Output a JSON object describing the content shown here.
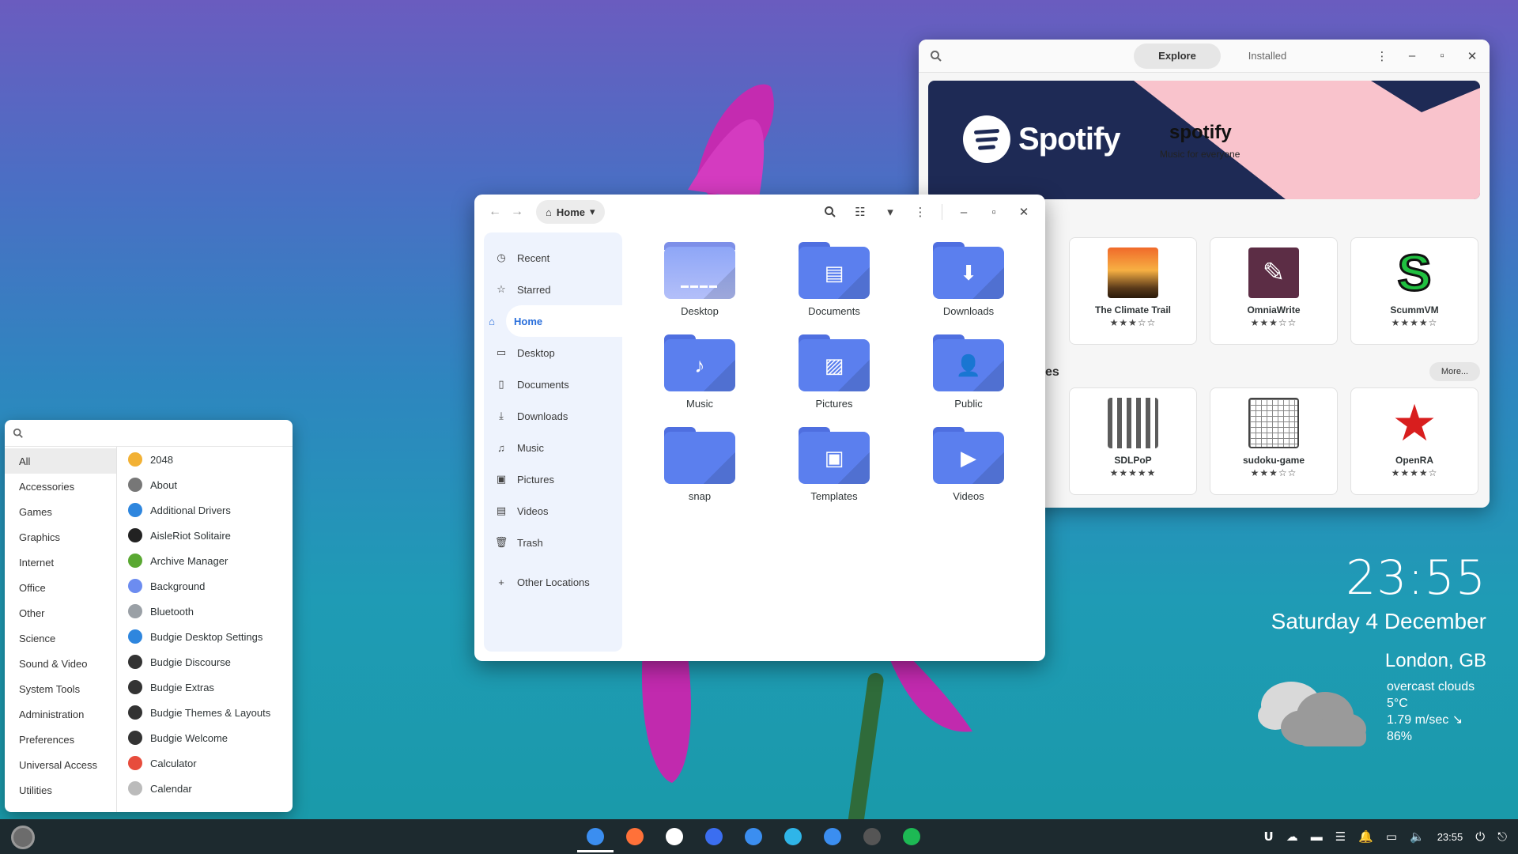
{
  "software": {
    "tabs": [
      "Explore",
      "Installed"
    ],
    "banner": {
      "logo_text": "Spotify",
      "title": "spotify",
      "subtitle": "Music for everyone",
      "colors": {
        "navy": "#1e2a55",
        "pink": "#f9c3cc"
      }
    },
    "section_label": "es",
    "more_label": "More...",
    "row1": [
      {
        "name": "The Climate Trail",
        "rating": 3
      },
      {
        "name": "OmniaWrite",
        "rating": 3
      },
      {
        "name": "ScummVM",
        "rating": 4
      }
    ],
    "row2": [
      {
        "name": "SDLPoP",
        "rating": 5
      },
      {
        "name": "sudoku-game",
        "rating": 3
      },
      {
        "name": "OpenRA",
        "rating": 4
      }
    ]
  },
  "files": {
    "path": "Home",
    "sidebar": [
      {
        "label": "Recent",
        "icon": "clock-icon"
      },
      {
        "label": "Starred",
        "icon": "star-icon"
      },
      {
        "label": "Home",
        "icon": "home-icon",
        "active": true
      },
      {
        "label": "Desktop",
        "icon": "desktop-icon"
      },
      {
        "label": "Documents",
        "icon": "document-icon"
      },
      {
        "label": "Downloads",
        "icon": "download-icon"
      },
      {
        "label": "Music",
        "icon": "music-icon"
      },
      {
        "label": "Pictures",
        "icon": "picture-icon"
      },
      {
        "label": "Videos",
        "icon": "video-icon"
      },
      {
        "label": "Trash",
        "icon": "trash-icon"
      },
      {
        "label": "Other Locations",
        "icon": "plus-icon"
      }
    ],
    "folders": [
      {
        "label": "Desktop",
        "icon": "desktop-folder-icon"
      },
      {
        "label": "Documents",
        "icon": "documents-folder-icon"
      },
      {
        "label": "Downloads",
        "icon": "downloads-folder-icon"
      },
      {
        "label": "Music",
        "icon": "music-folder-icon"
      },
      {
        "label": "Pictures",
        "icon": "pictures-folder-icon"
      },
      {
        "label": "Public",
        "icon": "public-folder-icon"
      },
      {
        "label": "snap",
        "icon": "folder-icon"
      },
      {
        "label": "Templates",
        "icon": "templates-folder-icon"
      },
      {
        "label": "Videos",
        "icon": "videos-folder-icon"
      }
    ]
  },
  "menu": {
    "search_placeholder": "",
    "categories": [
      "All",
      "Accessories",
      "Games",
      "Graphics",
      "Internet",
      "Office",
      "Other",
      "Science",
      "Sound & Video",
      "System Tools",
      "Administration",
      "Preferences",
      "Universal Access",
      "Utilities"
    ],
    "apps": [
      {
        "label": "2048",
        "color": "#f2b134"
      },
      {
        "label": "About",
        "color": "#777777"
      },
      {
        "label": "Additional Drivers",
        "color": "#2e86de"
      },
      {
        "label": "AisleRiot Solitaire",
        "color": "#222222"
      },
      {
        "label": "Archive Manager",
        "color": "#5aa832"
      },
      {
        "label": "Background",
        "color": "#6c8cf0"
      },
      {
        "label": "Bluetooth",
        "color": "#9aa0a6"
      },
      {
        "label": "Budgie Desktop Settings",
        "color": "#2e86de"
      },
      {
        "label": "Budgie Discourse",
        "color": "#333333"
      },
      {
        "label": "Budgie Extras",
        "color": "#333333"
      },
      {
        "label": "Budgie Themes & Layouts",
        "color": "#333333"
      },
      {
        "label": "Budgie Welcome",
        "color": "#333333"
      },
      {
        "label": "Calculator",
        "color": "#e74c3c"
      },
      {
        "label": "Calendar",
        "color": "#bbbbbb"
      }
    ]
  },
  "clock": {
    "time": "23:55",
    "date": "Saturday   4 December"
  },
  "weather": {
    "city": "London, GB",
    "description": "overcast clouds",
    "temp": "5°C",
    "wind": "1.79 m/sec ↘",
    "humidity": "86%"
  },
  "panel": {
    "time": "23:55",
    "taskbar_colors": [
      "#3b8ef0",
      "#ff7139",
      "#ffffff",
      "#3b6ef0",
      "#3b8ef0",
      "#2fb5e8",
      "#3b8ef0",
      "#555555",
      "#1db954"
    ]
  }
}
